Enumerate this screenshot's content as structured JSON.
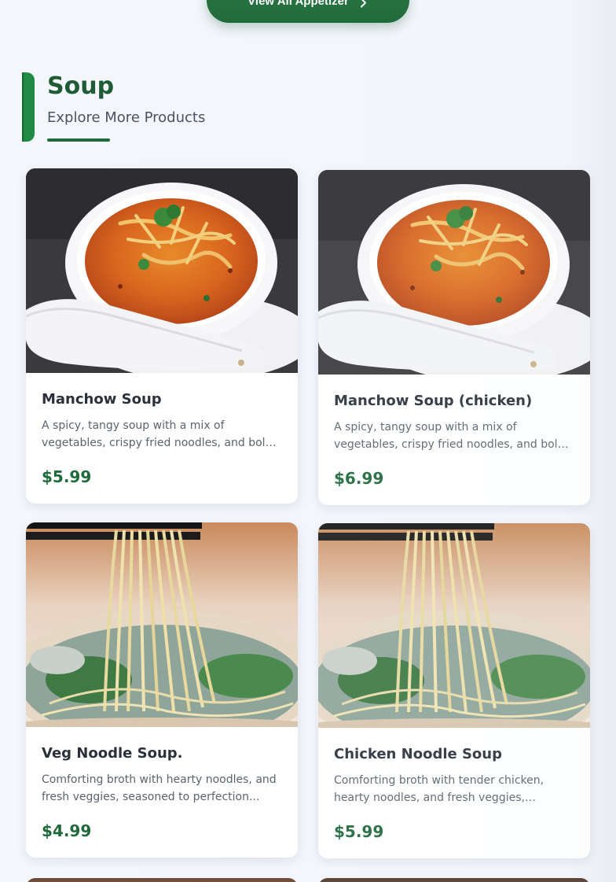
{
  "top_button": {
    "label": "View All Appetizer",
    "icon": "chevron-right-icon"
  },
  "section": {
    "title": "Soup",
    "subtitle": "Explore More Products"
  },
  "products": [
    {
      "name": "Manchow Soup",
      "description": "A spicy, tangy soup with a mix of vegetables, crispy fried noodles, and bold flavors.",
      "price": "$5.99",
      "image": "manchow-soup-photo"
    },
    {
      "name": "Manchow Soup (chicken)",
      "description": "A spicy, tangy soup with a mix of vegetables, crispy fried noodles, and bold flavors.",
      "price": "$6.99",
      "image": "manchow-soup-photo"
    },
    {
      "name": "Veg Noodle Soup.",
      "description": "Comforting broth with hearty noodles, and fresh veggies, seasoned to perfection...",
      "price": "$4.99",
      "image": "noodle-soup-photo"
    },
    {
      "name": "Chicken Noodle Soup",
      "description": "Comforting broth with tender chicken, hearty noodles, and fresh veggies, seasoned to perfection.",
      "price": "$5.99",
      "image": "noodle-soup-photo"
    }
  ],
  "colors": {
    "brand_green": "#1f6a3a",
    "accent_green": "#1e8a43",
    "title_green": "#1f5c35",
    "background": "#f3f6fb"
  }
}
